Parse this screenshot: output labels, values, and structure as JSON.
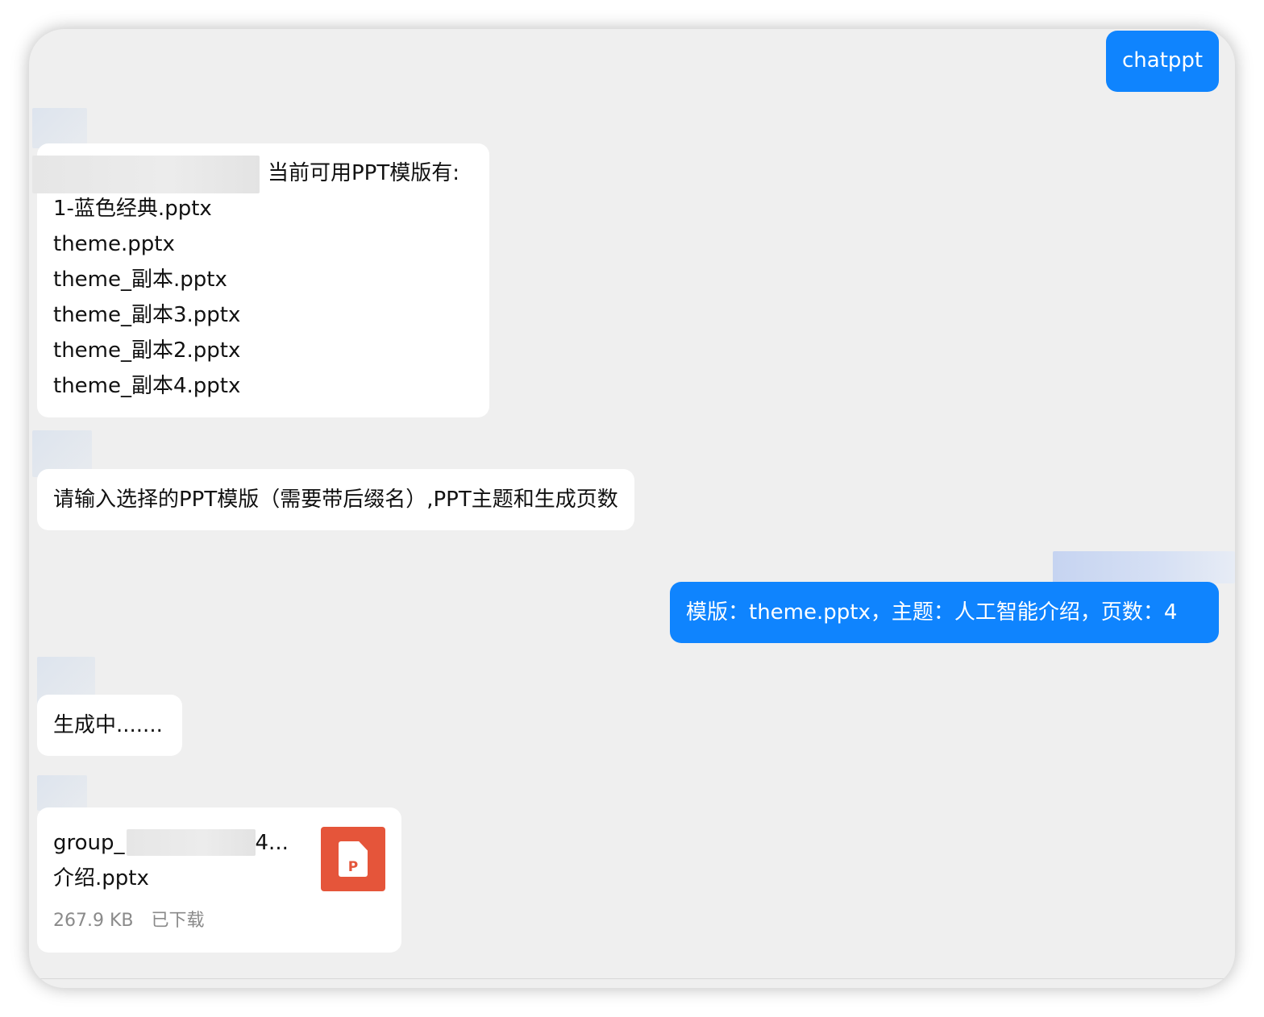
{
  "chat": {
    "messages": [
      {
        "side": "right",
        "text": "chatppt"
      },
      {
        "side": "left",
        "header_suffix": "当前可用PPT模版有:",
        "lines": [
          "1-蓝色经典.pptx",
          "theme.pptx",
          "theme_副本.pptx",
          "theme_副本3.pptx",
          "theme_副本2.pptx",
          "theme_副本4.pptx"
        ]
      },
      {
        "side": "left",
        "text": "请输入选择的PPT模版（需要带后缀名）,PPT主题和生成页数"
      },
      {
        "side": "right",
        "text": "模版：theme.pptx，主题：人工智能介绍，页数：4"
      },
      {
        "side": "left",
        "text": "生成中......."
      },
      {
        "side": "left",
        "file": {
          "name_prefix": "group_",
          "name_suffix": "4...",
          "name_line2": "介绍.pptx",
          "size": "267.9 KB",
          "status": "已下载",
          "icon": "ppt-file-icon",
          "icon_letter": "P",
          "icon_color": "#e5553a"
        }
      }
    ]
  },
  "colors": {
    "background": "#efefef",
    "incoming_bubble": "#ffffff",
    "outgoing_bubble": "#0f84fe"
  }
}
